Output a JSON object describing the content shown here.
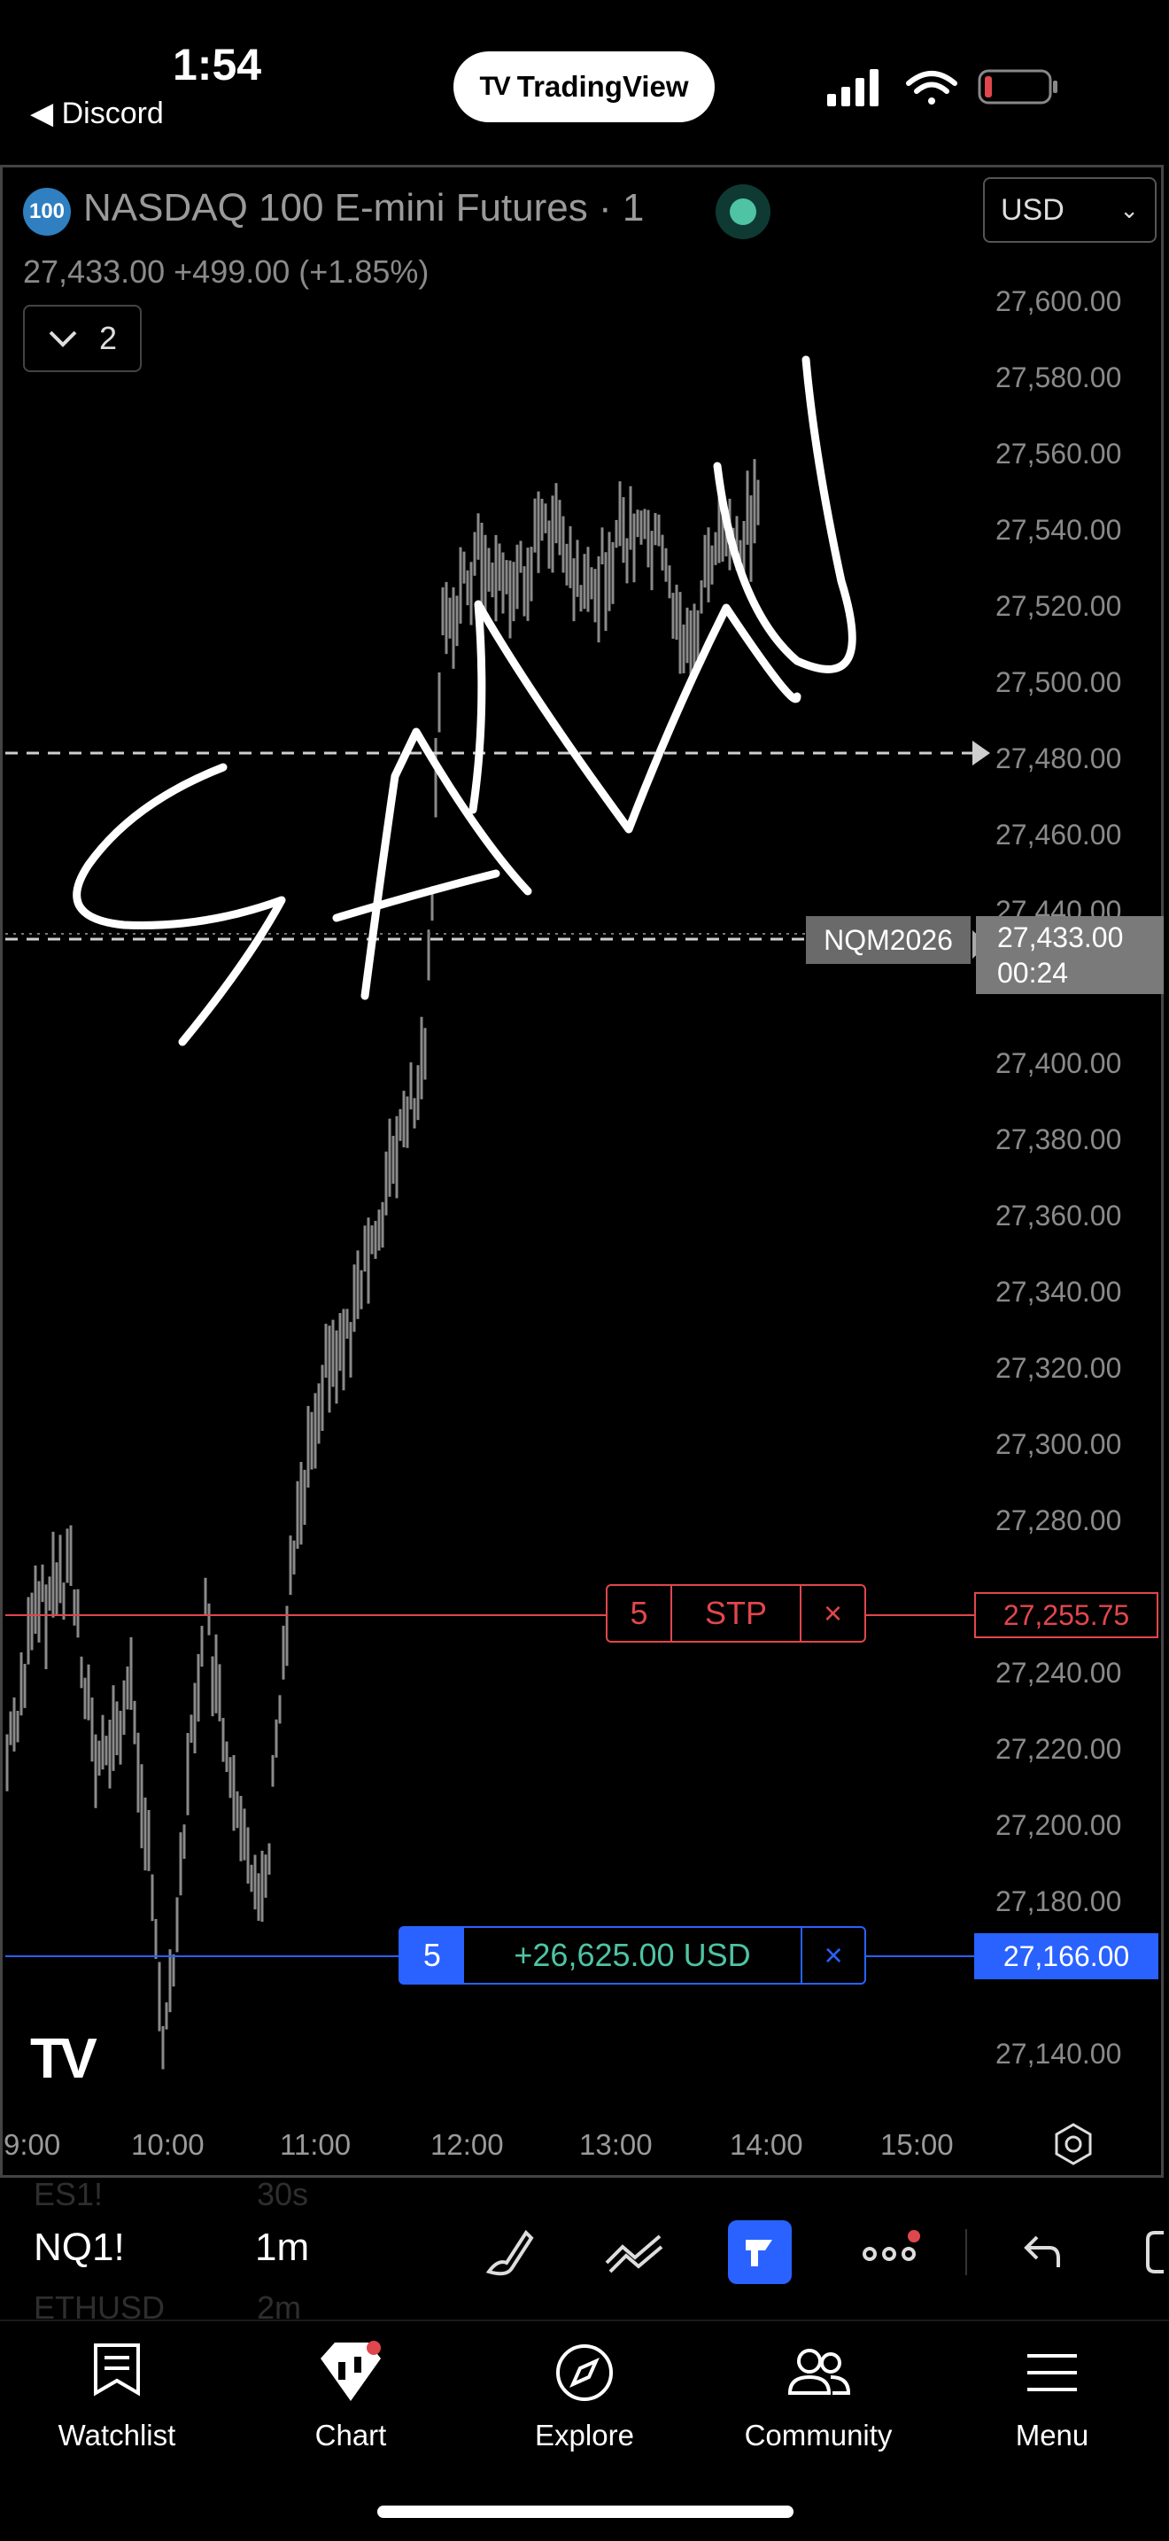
{
  "status_bar": {
    "time": "1:54",
    "back_label": "◀ Discord",
    "app_pill": "TradingView"
  },
  "header": {
    "badge": "100",
    "title": "NASDAQ 100 E-mini Futures · 1",
    "quote": "27,433.00  +499.00 (+1.85%)",
    "currency": "USD",
    "collapse_count": "2"
  },
  "price_axis": [
    "27,600.00",
    "27,580.00",
    "27,560.00",
    "27,540.00",
    "27,520.00",
    "27,500.00",
    "27,480.00",
    "27,460.00",
    "27,440.00",
    "27,400.00",
    "27,380.00",
    "27,360.00",
    "27,340.00",
    "27,320.00",
    "27,300.00",
    "27,280.00",
    "27,240.00",
    "27,220.00",
    "27,200.00",
    "27,180.00",
    "27,140.00"
  ],
  "time_axis": [
    "9:00",
    "10:00",
    "11:00",
    "12:00",
    "13:00",
    "14:00",
    "15:00"
  ],
  "labels": {
    "symbol": "NQM2026",
    "current_price": "27,433.00",
    "countdown": "00:24",
    "stop_price": "27,255.75",
    "entry_price": "27,166.00"
  },
  "orders": {
    "stop": {
      "qty": "5",
      "type": "STP",
      "close": "×"
    },
    "position": {
      "qty": "5",
      "pnl": "+26,625.00 USD",
      "close": "×"
    }
  },
  "toolbar": {
    "symbol": "NQ1!",
    "interval": "1m",
    "ghost_above": [
      "ES1!",
      "30s"
    ],
    "ghost_below": [
      "ETHUSD",
      "2m"
    ]
  },
  "nav": [
    {
      "label": "Watchlist"
    },
    {
      "label": "Chart"
    },
    {
      "label": "Explore"
    },
    {
      "label": "Community"
    },
    {
      "label": "Menu"
    }
  ],
  "colors": {
    "accent_blue": "#2962ff",
    "stop_red": "#e0474c",
    "pnl_green": "#4fc3a3",
    "candle_gray": "#8a8a8a"
  }
}
